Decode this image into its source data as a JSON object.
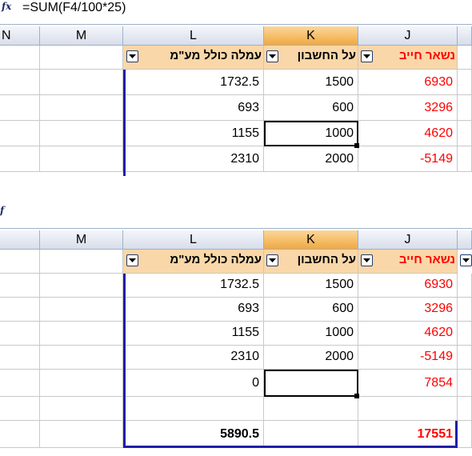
{
  "formula_bar": {
    "fx_label": "fx",
    "formula": "=SUM(F4/100*25)"
  },
  "columns": {
    "n": "N",
    "m": "M",
    "l": "L",
    "k": "K",
    "j": "J"
  },
  "table_headers": {
    "l": "עמלה כולל מע\"מ",
    "k": "על החשבון",
    "j": "נשאר חייב"
  },
  "top_rows": [
    {
      "l": "1732.5",
      "k": "1500",
      "j": "6930"
    },
    {
      "l": "693",
      "k": "600",
      "j": "3296"
    },
    {
      "l": "1155",
      "k": "1000",
      "j": "4620"
    },
    {
      "l": "2310",
      "k": "2000",
      "j": "-5149"
    }
  ],
  "bottom_rows": [
    {
      "l": "1732.5",
      "k": "1500",
      "j": "6930"
    },
    {
      "l": "693",
      "k": "600",
      "j": "3296"
    },
    {
      "l": "1155",
      "k": "1000",
      "j": "4620"
    },
    {
      "l": "2310",
      "k": "2000",
      "j": "-5149"
    },
    {
      "l": "0",
      "k": "",
      "j": "7854"
    },
    {
      "l": "",
      "k": "",
      "j": ""
    }
  ],
  "totals": {
    "l": "5890.5",
    "j": "17551"
  },
  "colors": {
    "header_fill": "#fad7a8",
    "active_col": "#f0a842",
    "table_border": "#1f1fa8",
    "negative_red": "#ff0000"
  }
}
